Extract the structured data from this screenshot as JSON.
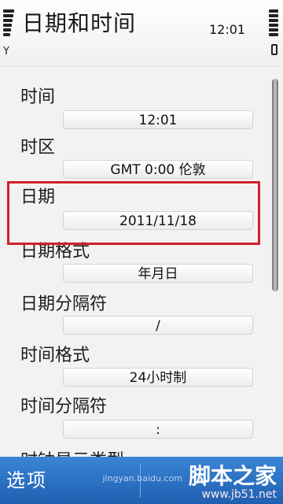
{
  "status": {
    "title": "日期和时间",
    "time": "12:01"
  },
  "settings": [
    {
      "label": "时间",
      "value": "12:01"
    },
    {
      "label": "时区",
      "value": "GMT  0:00  伦敦"
    },
    {
      "label": "日期",
      "value": "2011/11/18"
    },
    {
      "label": "日期格式",
      "value": "年月日"
    },
    {
      "label": "日期分隔符",
      "value": "/"
    },
    {
      "label": "时间格式",
      "value": "24小时制"
    },
    {
      "label": "时间分隔符",
      "value": ":"
    },
    {
      "label": "时钟显示类型",
      "value": ""
    }
  ],
  "softkeys": {
    "left": "选项"
  },
  "watermark": {
    "brand": "jingyan.baidu.com",
    "site": "脚本之家",
    "url": "www.jb51.net"
  },
  "colors": {
    "highlight": "#d0202a",
    "softkey_bar": "#2a6fc4"
  },
  "icons": [
    "signal-strength-icon",
    "antenna-icon",
    "battery-level-icon",
    "battery-icon"
  ],
  "scroll_position": 0.0
}
